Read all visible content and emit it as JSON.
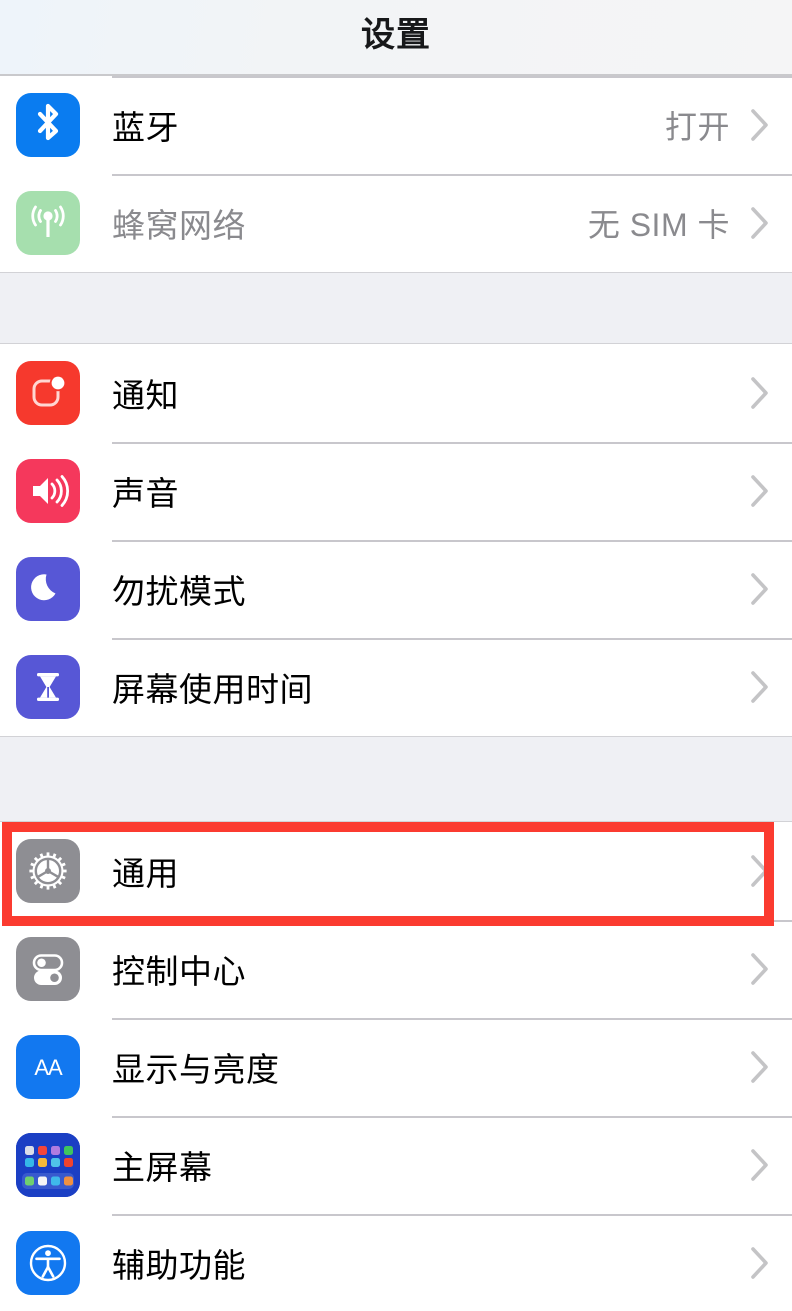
{
  "app": {
    "platform": "ios-settings",
    "title": "设置"
  },
  "colors": {
    "navbar_bg": "#f2f4f6",
    "group_gap_bg": "#eff0f4",
    "separator": "#c8c7cc",
    "row_bg": "#ffffff",
    "label": "#000000",
    "label_disabled": "#8a8a8e",
    "value": "#8a8a8e",
    "chevron": "#c4c4c6",
    "highlight": "#fb3b30",
    "icon_bluetooth": "#0a7cf0",
    "icon_cellular": "#a6dfae",
    "icon_notifications": "#f6392d",
    "icon_sounds": "#f5385c",
    "icon_dnd": "#5757d6",
    "icon_screentime": "#5757d6",
    "icon_general": "#8e8e93",
    "icon_control_center": "#8e8e93",
    "icon_display": "#1278f0",
    "icon_home_screen": "#1b3fc4",
    "icon_accessibility": "#1278f0"
  },
  "groups": [
    {
      "id": "connectivity",
      "rows": [
        {
          "id": "bluetooth",
          "label": "蓝牙",
          "value": "打开",
          "icon": "bluetooth-icon",
          "disabled": false
        },
        {
          "id": "cellular",
          "label": "蜂窝网络",
          "value": "无 SIM 卡",
          "icon": "cellular-icon",
          "disabled": true
        }
      ]
    },
    {
      "id": "alerts",
      "rows": [
        {
          "id": "notifications",
          "label": "通知",
          "value": "",
          "icon": "notifications-icon",
          "disabled": false
        },
        {
          "id": "sounds",
          "label": "声音",
          "value": "",
          "icon": "sounds-icon",
          "disabled": false
        },
        {
          "id": "do-not-disturb",
          "label": "勿扰模式",
          "value": "",
          "icon": "moon-icon",
          "disabled": false
        },
        {
          "id": "screen-time",
          "label": "屏幕使用时间",
          "value": "",
          "icon": "hourglass-icon",
          "disabled": false
        }
      ]
    },
    {
      "id": "system",
      "rows": [
        {
          "id": "general",
          "label": "通用",
          "value": "",
          "icon": "gear-icon",
          "disabled": false,
          "highlighted": true
        },
        {
          "id": "control-center",
          "label": "控制中心",
          "value": "",
          "icon": "control-center-icon",
          "disabled": false
        },
        {
          "id": "display-brightness",
          "label": "显示与亮度",
          "value": "",
          "icon": "display-aa-icon",
          "disabled": false
        },
        {
          "id": "home-screen",
          "label": "主屏幕",
          "value": "",
          "icon": "home-screen-grid-icon",
          "disabled": false
        },
        {
          "id": "accessibility",
          "label": "辅助功能",
          "value": "",
          "icon": "accessibility-icon",
          "disabled": false
        }
      ]
    }
  ]
}
